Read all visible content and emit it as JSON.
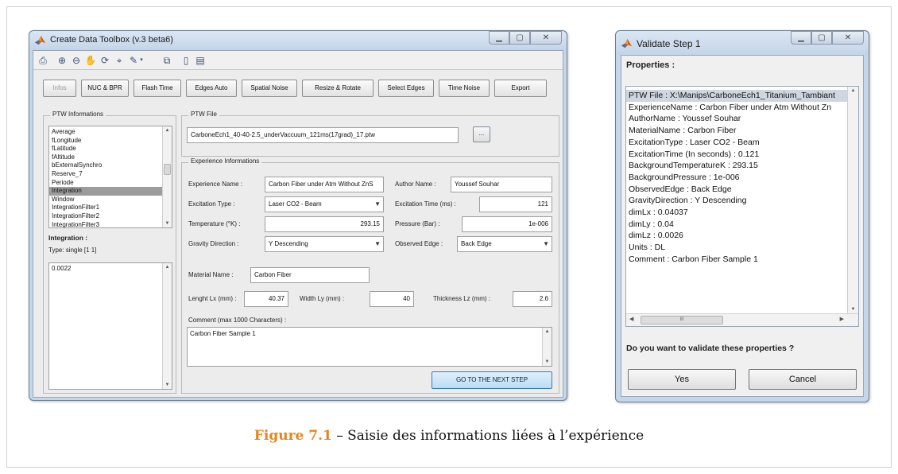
{
  "main_window": {
    "title": "Create Data Toolbox (v.3 beta6)",
    "tabs": [
      {
        "label": "Infos",
        "disabled": true
      },
      {
        "label": "NUC & BPR",
        "disabled": false
      },
      {
        "label": "Flash Time",
        "disabled": false
      },
      {
        "label": "Edges Auto",
        "disabled": false
      },
      {
        "label": "Spatial Noise",
        "disabled": false
      },
      {
        "label": "Resize & Rotate",
        "disabled": false
      },
      {
        "label": "Select Edges",
        "disabled": false
      },
      {
        "label": "Time Noise",
        "disabled": false
      },
      {
        "label": "Export",
        "disabled": false
      }
    ],
    "ptw_info": {
      "label": "PTW Informations",
      "items": [
        "Average",
        "fLongitude",
        "fLatitude",
        "fAltitude",
        "bExternalSynchro",
        "Reserve_7",
        "Periode",
        "Integration",
        "Window",
        "IntegrationFilter1",
        "IntegrationFilter2",
        "IntegrationFilter3"
      ],
      "selected_index": 7,
      "selected_name": "Integration :",
      "type_text": "Type: single [1  1]",
      "value": "0.0022"
    },
    "ptw_file": {
      "label": "PTW File",
      "value": "CarboneEch1_40-40-2.5_underVaccuum_121ms(17grad)_17.ptw",
      "browse_label": "..."
    },
    "experience": {
      "label": "Experience Informations",
      "experience_name_label": "Experience Name :",
      "experience_name": "Carbon Fiber under Atm Without ZnS",
      "author_name_label": "Author Name :",
      "author_name": "Youssef Souhar",
      "excitation_type_label": "Excitation Type :",
      "excitation_type": "Laser CO2 - Beam",
      "excitation_time_label": "Excitation Time (ms) :",
      "excitation_time": "121",
      "temperature_label": "Temperature (°K) :",
      "temperature": "293.15",
      "pressure_label": "Pressure (Bar) :",
      "pressure": "1e-006",
      "gravity_label": "Gravity Direction :",
      "gravity": "Y Descending",
      "observed_edge_label": "Observed Edge :",
      "observed_edge": "Back Edge",
      "material_label": "Material Name :",
      "material": "Carbon Fiber",
      "length_label": "Lenght Lx (mm) :",
      "length": "40.37",
      "width_label": "Width Ly (mm) :",
      "width": "40",
      "thickness_label": "Thickness Lz (mm) :",
      "thickness": "2.6",
      "comment_label": "Comment (max 1000 Characters) :",
      "comment": "Carbon Fiber Sample 1",
      "next_button": "GO TO THE NEXT STEP"
    }
  },
  "dialog": {
    "title": "Validate Step 1",
    "properties_label": "Properties :",
    "properties": [
      "PTW File : X:\\Manips\\CarboneEch1_Titanium_Tambiant",
      "ExperienceName : Carbon Fiber under Atm Without Zn",
      "AuthorName : Youssef Souhar",
      "MaterialName : Carbon Fiber",
      "ExcitationType : Laser CO2 - Beam",
      "ExcitationTime (In seconds) : 0.121",
      "BackgroundTemperatureK : 293.15",
      "BackgroundPressure : 1e-006",
      "ObservedEdge : Back Edge",
      "GravityDirection : Y Descending",
      "dimLx : 0.04037",
      "dimLy : 0.04",
      "dimLz : 0.0026",
      "Units : DL",
      "Comment : Carbon Fiber Sample 1"
    ],
    "hscroll_thumb_label": "III",
    "question": "Do you want to validate these properties ?",
    "yes_label": "Yes",
    "cancel_label": "Cancel"
  },
  "caption": {
    "figure": "Figure 7.1",
    "text": " – Saisie des informations liées à l’expérience"
  }
}
